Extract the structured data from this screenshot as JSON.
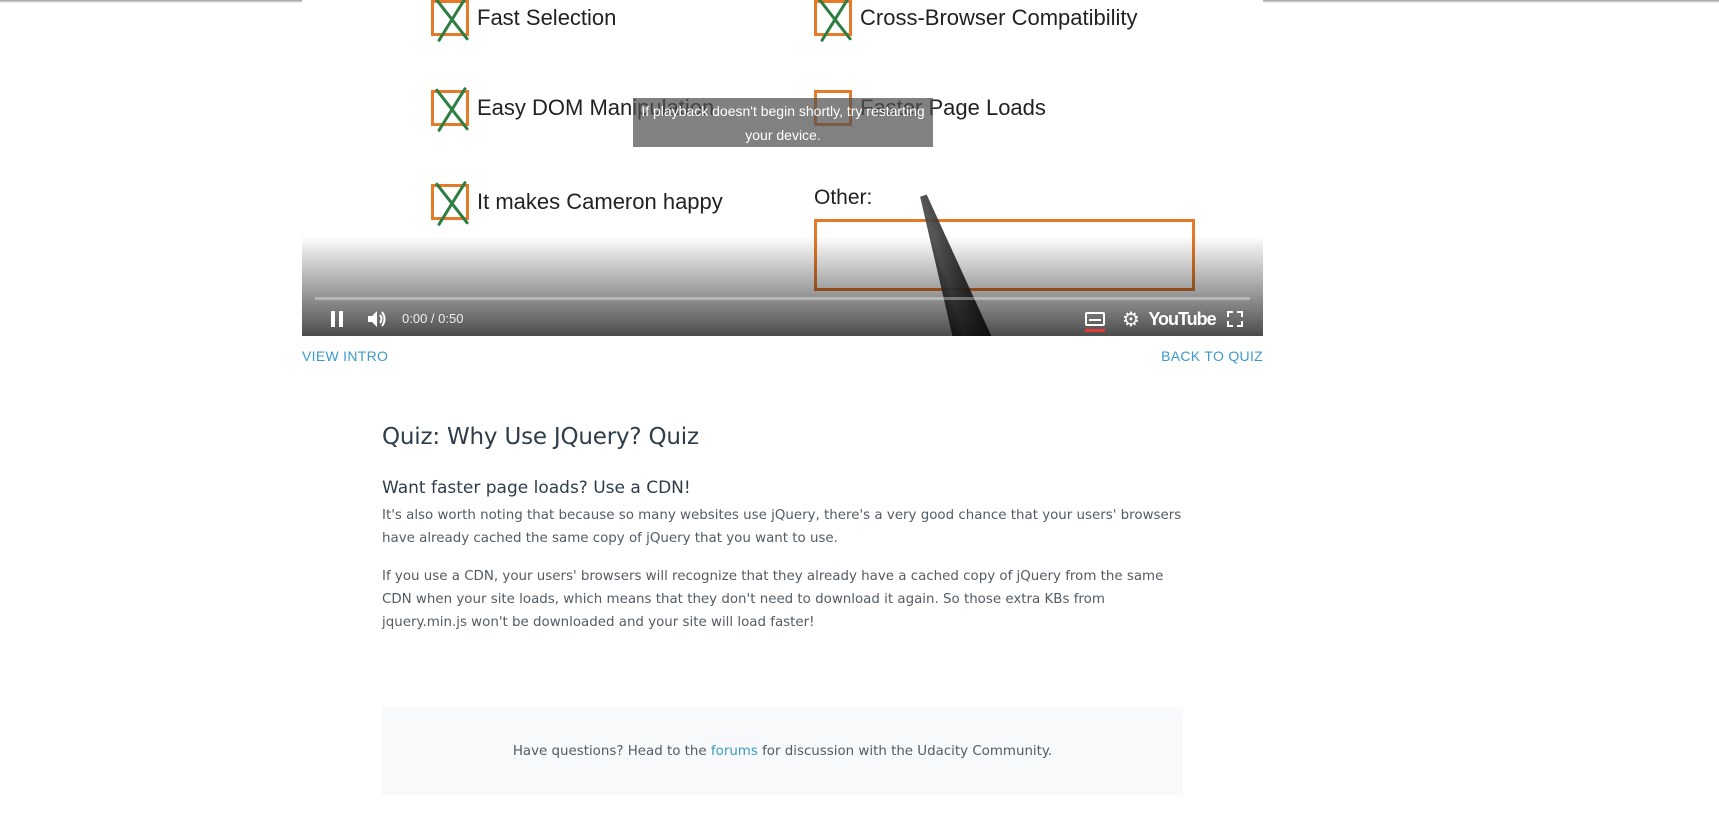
{
  "video": {
    "options_left": [
      "Fast Selection",
      "Easy DOM Manipulation",
      "It makes Cameron happy"
    ],
    "options_right": [
      "Cross-Browser Compatibility",
      "Faster Page Loads"
    ],
    "other_label": "Other:",
    "toast": "If playback doesn't begin shortly, try restarting your device.",
    "time": "0:00 / 0:50",
    "logo": "YouTube",
    "icons": [
      "pause-icon",
      "volume-icon",
      "captions-icon",
      "gear-icon",
      "fullscreen-icon"
    ],
    "progress": 0
  },
  "nav": {
    "view_intro": "VIEW INTRO",
    "back_to_quiz": "BACK TO QUIZ"
  },
  "article": {
    "title": "Quiz: Why Use JQuery? Quiz",
    "heading": "Want faster page loads? Use a CDN!",
    "paragraph1": "It's also worth noting that because so many websites use jQuery, there's a very good chance that your users' browsers have already cached the same copy of jQuery that you want to use.",
    "paragraph2": "If you use a CDN, your users' browsers will recognize that they already have a cached copy of jQuery from the same CDN when your site loads, which means that they don't need to download it again. So those extra KBs from jquery.min.js won't be downloaded and your site will load faster!"
  },
  "footer": {
    "before": "Have questions? Head to the ",
    "link": "forums",
    "after": " for discussion with the Udacity Community."
  },
  "colors": {
    "link": "#3d9ac9",
    "checkbox": "#e57a2a",
    "check_mark": "#2e7d42"
  }
}
